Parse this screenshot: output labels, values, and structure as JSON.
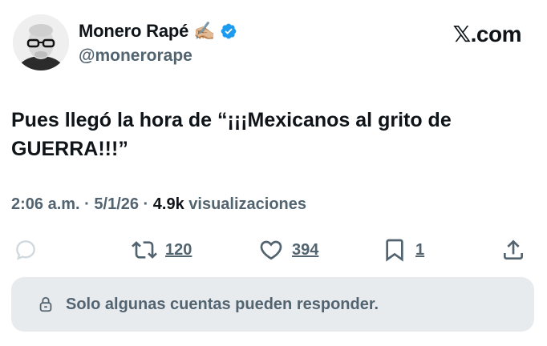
{
  "author": {
    "display_name": "Monero Rapé",
    "emoji": "✍🏼",
    "handle": "@monerorape",
    "verified": true,
    "verified_color": "#1d9bf0"
  },
  "brand": {
    "x_glyph": "𝕏",
    "suffix": ".com"
  },
  "tweet": {
    "text": "Pues llegó la hora de “¡¡¡Mexicanos al grito de GUERRA!!!”"
  },
  "meta": {
    "time": "2:06 a.m.",
    "sep": " · ",
    "date": "5/1/26",
    "sep2": " · ",
    "views_count": "4.9k",
    "views_label": " visualizaciones"
  },
  "actions": {
    "replies": "",
    "retweets": "120",
    "likes": "394",
    "bookmarks": "1"
  },
  "reply_restriction": {
    "text": "Solo algunas cuentas pueden responder."
  },
  "colors": {
    "text_primary": "#0f1419",
    "text_secondary": "#536471",
    "reply_bar_bg": "#e8ebee"
  }
}
